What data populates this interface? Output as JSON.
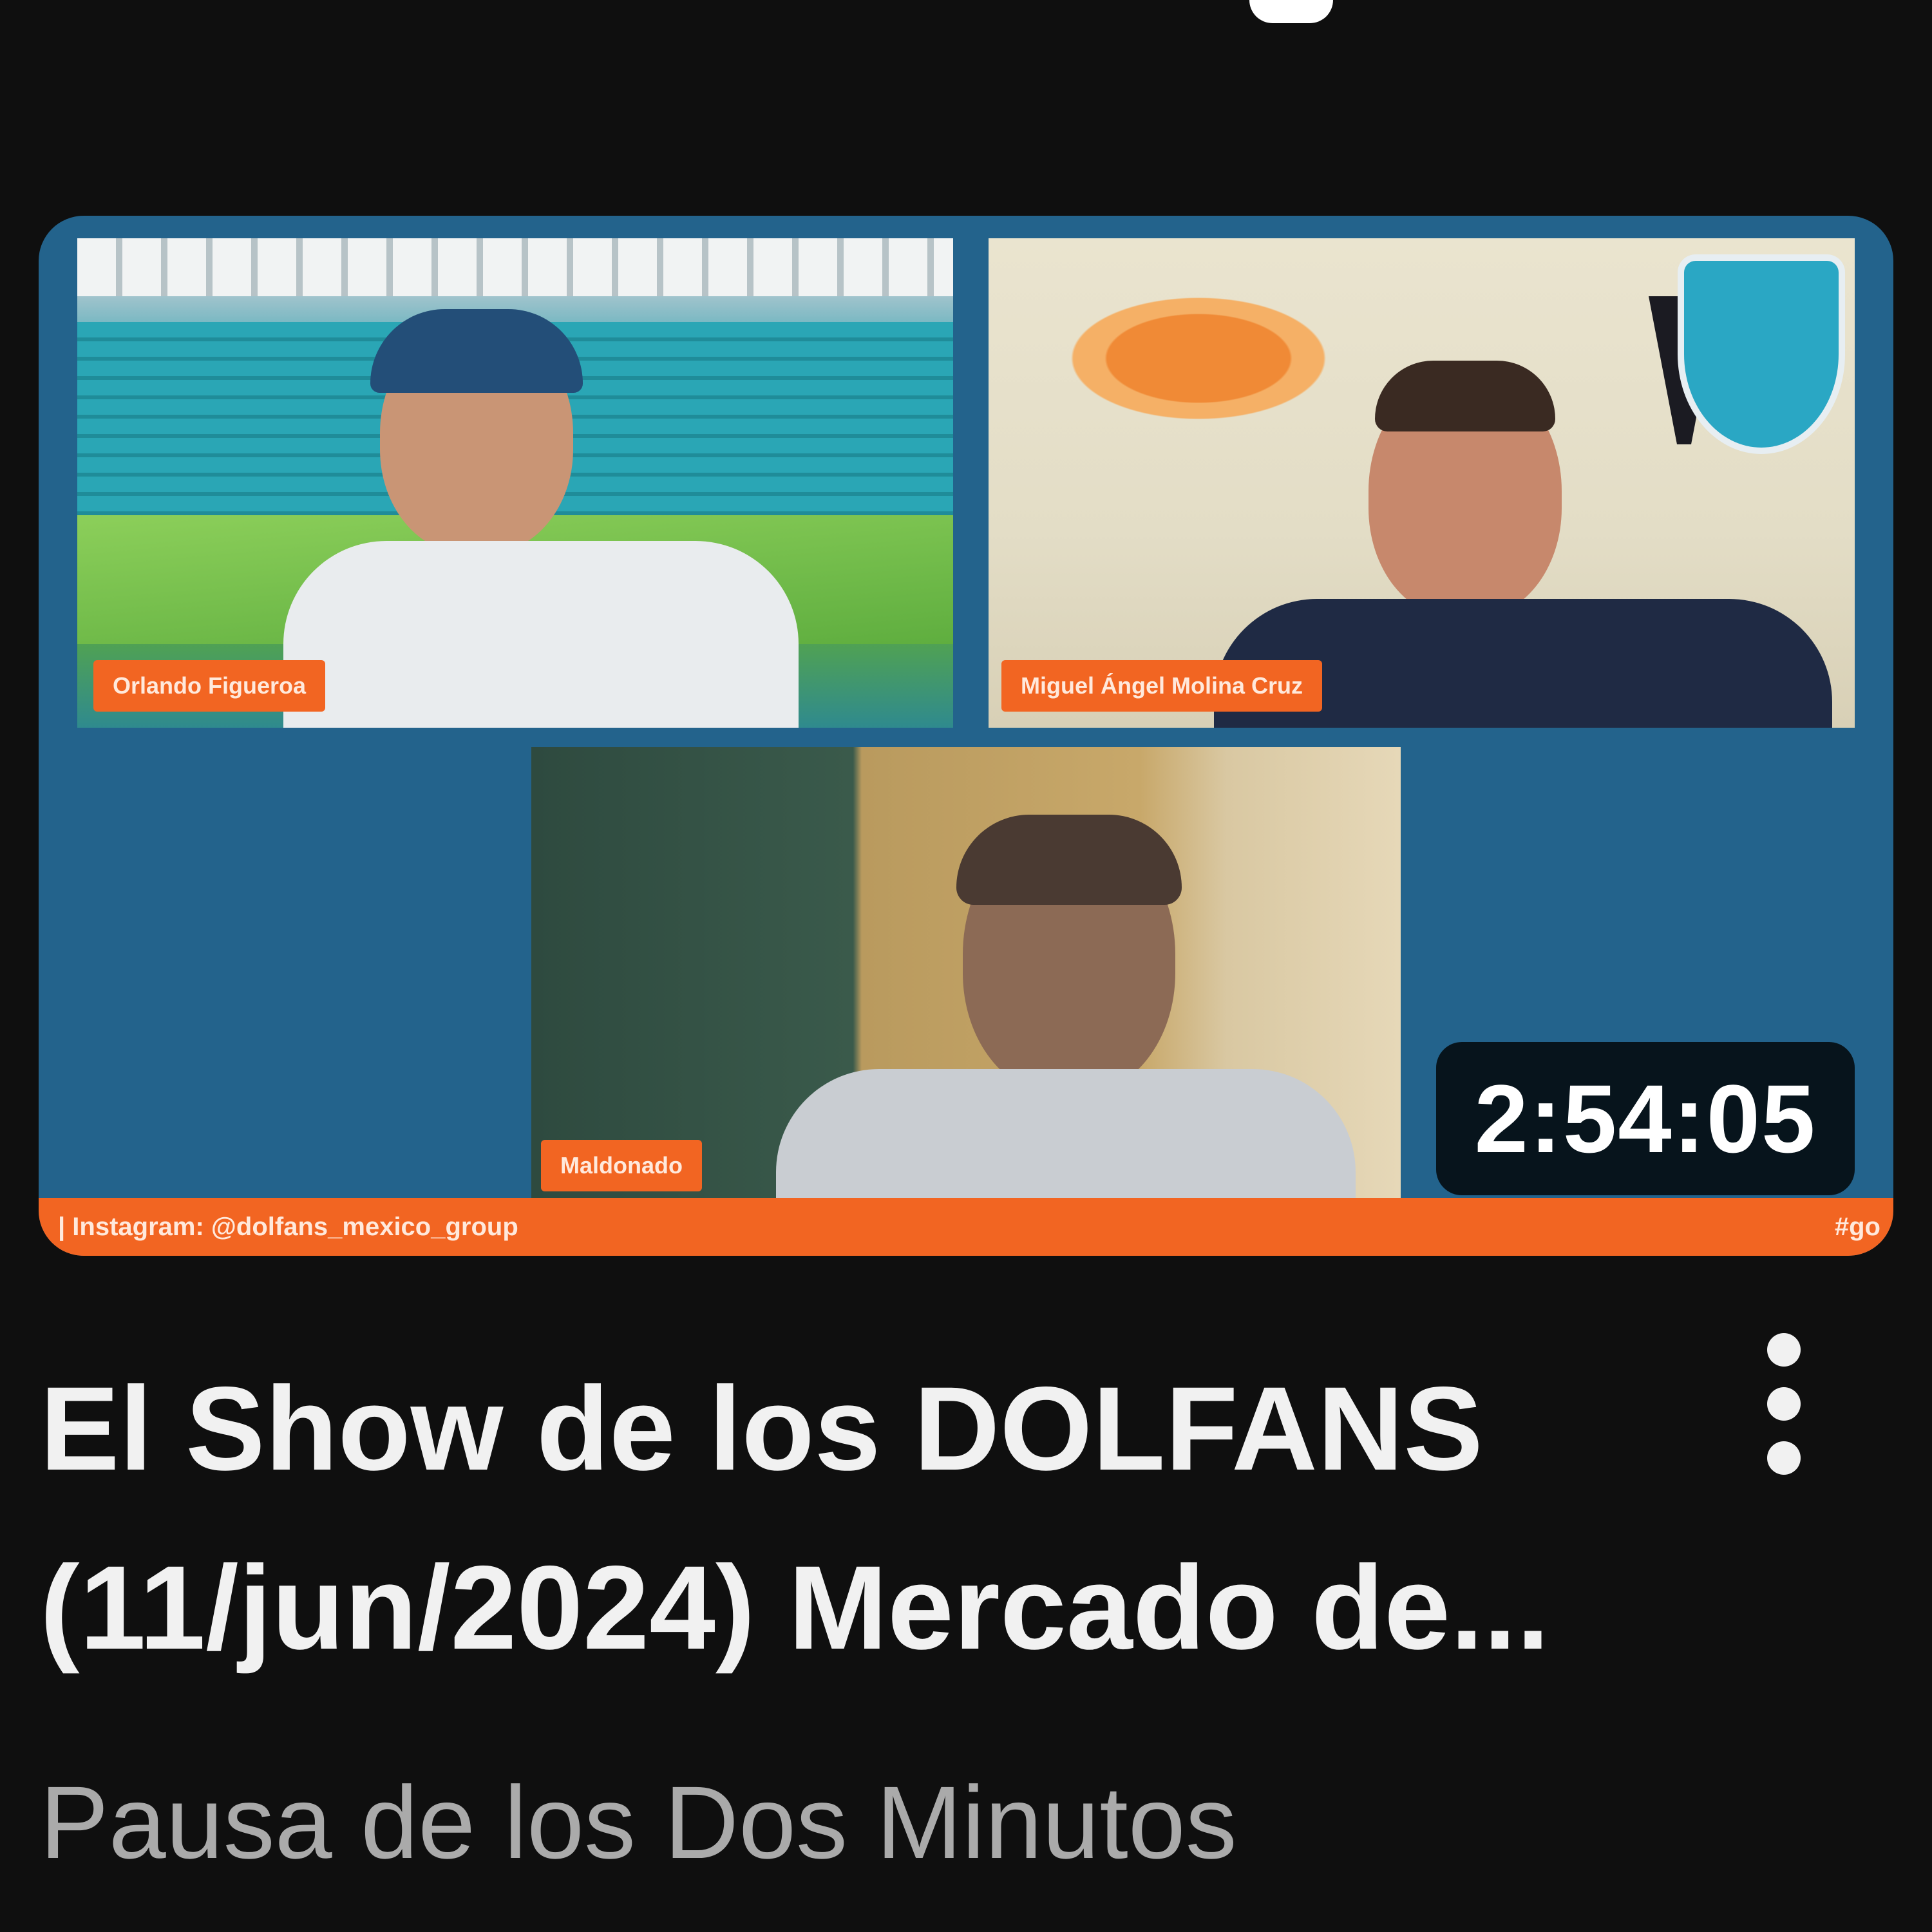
{
  "video": {
    "duration": "2:54:05",
    "title": "El Show de los DOLFANS (11/jun/2024) Mercado de...",
    "channel": "Pausa de los Dos Minutos",
    "menu_icon": "more-vertical-icon"
  },
  "thumbnail": {
    "name_tags": [
      "Orlando Figueroa",
      "Miguel Ángel Molina Cruz",
      "Maldonado"
    ],
    "ticker_left": "| Instagram: @dolfans_mexico_group",
    "ticker_right": "#go"
  },
  "colors": {
    "background": "#0f0f0f",
    "accent_orange": "#f26522",
    "thumb_blue": "#23638c",
    "title_text": "#f1f1f1",
    "channel_text": "#aaaaaa"
  }
}
